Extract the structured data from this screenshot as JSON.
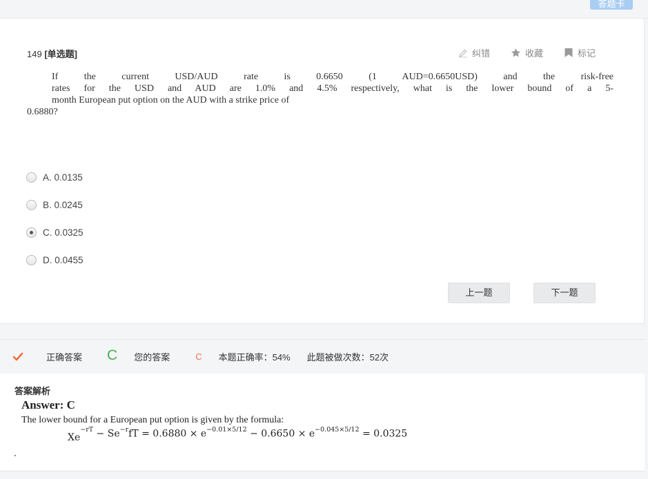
{
  "top": {
    "answer_sheet_label": "答题卡"
  },
  "question": {
    "number": "149",
    "type": "[单选题]",
    "tools": {
      "report": "纠错",
      "favorite": "收藏",
      "mark": "标记"
    },
    "stem_lines": [
      "If the current USD/AUD rate is 0.6650 (1 AUD=0.6650USD) and the risk-free",
      "rates for the USD and AUD are 1.0% and 4.5% respectively, what is the lower bound of a 5-",
      "month European put option on the AUD with a strike price of",
      "0.6880?"
    ],
    "options": [
      {
        "label": "A. 0.0135",
        "selected": false
      },
      {
        "label": "B. 0.0245",
        "selected": false
      },
      {
        "label": "C. 0.0325",
        "selected": true
      },
      {
        "label": "D. 0.0455",
        "selected": false
      }
    ],
    "prev_label": "上一题",
    "next_label": "下一题"
  },
  "result": {
    "correct_label": "正确答案",
    "correct_answer": "C",
    "your_label": "您的答案",
    "your_answer": "C",
    "accuracy": "本题正确率：54%",
    "times_done": "此题被做次数：52次",
    "colors": {
      "correct": "#4caf50",
      "yours": "#f27049",
      "check": "#f26b3a"
    }
  },
  "analysis": {
    "title": "答案解析",
    "answer": "Answer: C",
    "explanation": "The lower bound for a European put option is given by the formula:",
    "formula": {
      "lhs_a": "Xe",
      "lhs_a_sup": "−rT",
      "lhs_mid": " − Se",
      "lhs_b_sup": "−r",
      "lhs_b_tail": "fT",
      "eq1": " = 0.6880 × e",
      "exp1": "−0.01×5/12",
      "mid": " − 0.6650 × e",
      "exp2": "−0.045×5/12",
      "result": " = 0.0325"
    }
  }
}
